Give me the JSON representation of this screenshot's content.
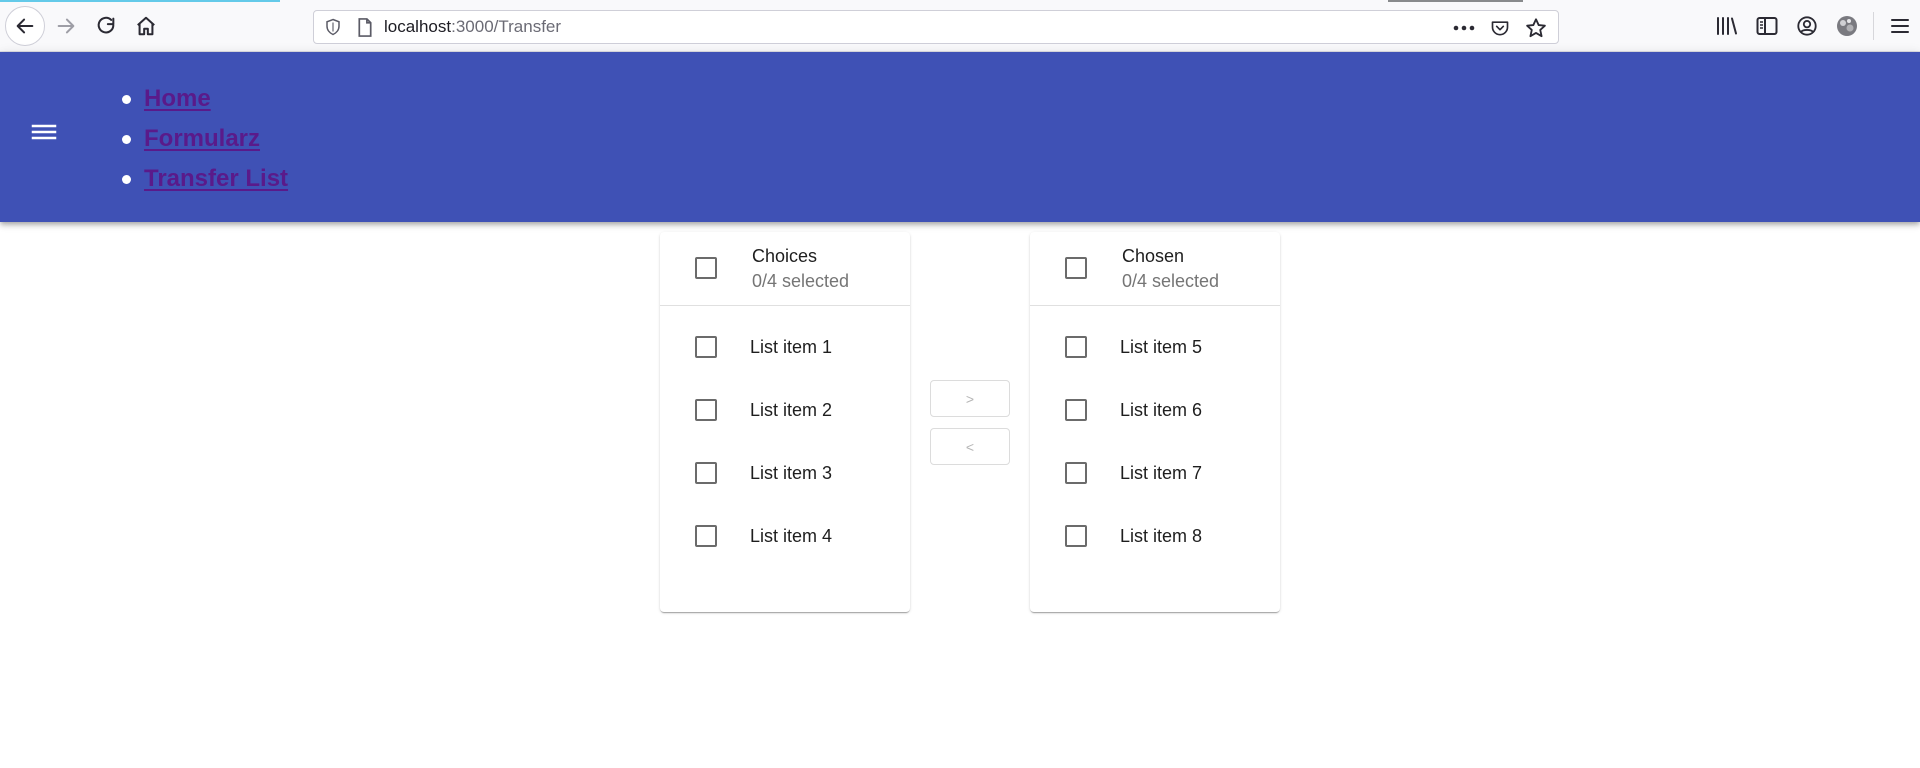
{
  "browser": {
    "url_host": "localhost",
    "url_path": ":3000/Transfer",
    "icons": [
      "back-arrow-icon",
      "forward-arrow-icon",
      "reload-icon",
      "home-icon",
      "shield-icon",
      "page-icon",
      "more-dots-icon",
      "pocket-icon",
      "star-icon",
      "library-icon",
      "sidebar-icon",
      "account-icon",
      "extension-icon",
      "hamburger-menu-icon"
    ]
  },
  "app_bar": {
    "color": "#3f51b5",
    "nav_links": [
      {
        "label": "Home"
      },
      {
        "label": "Formularz"
      },
      {
        "label": "Transfer List"
      }
    ]
  },
  "transfer": {
    "left": {
      "title": "Choices",
      "subtitle": "0/4 selected",
      "items": [
        "List item 1",
        "List item 2",
        "List item 3",
        "List item 4"
      ]
    },
    "right": {
      "title": "Chosen",
      "subtitle": "0/4 selected",
      "items": [
        "List item 5",
        "List item 6",
        "List item 7",
        "List item 8"
      ]
    },
    "move_right_label": ">",
    "move_left_label": "<"
  }
}
